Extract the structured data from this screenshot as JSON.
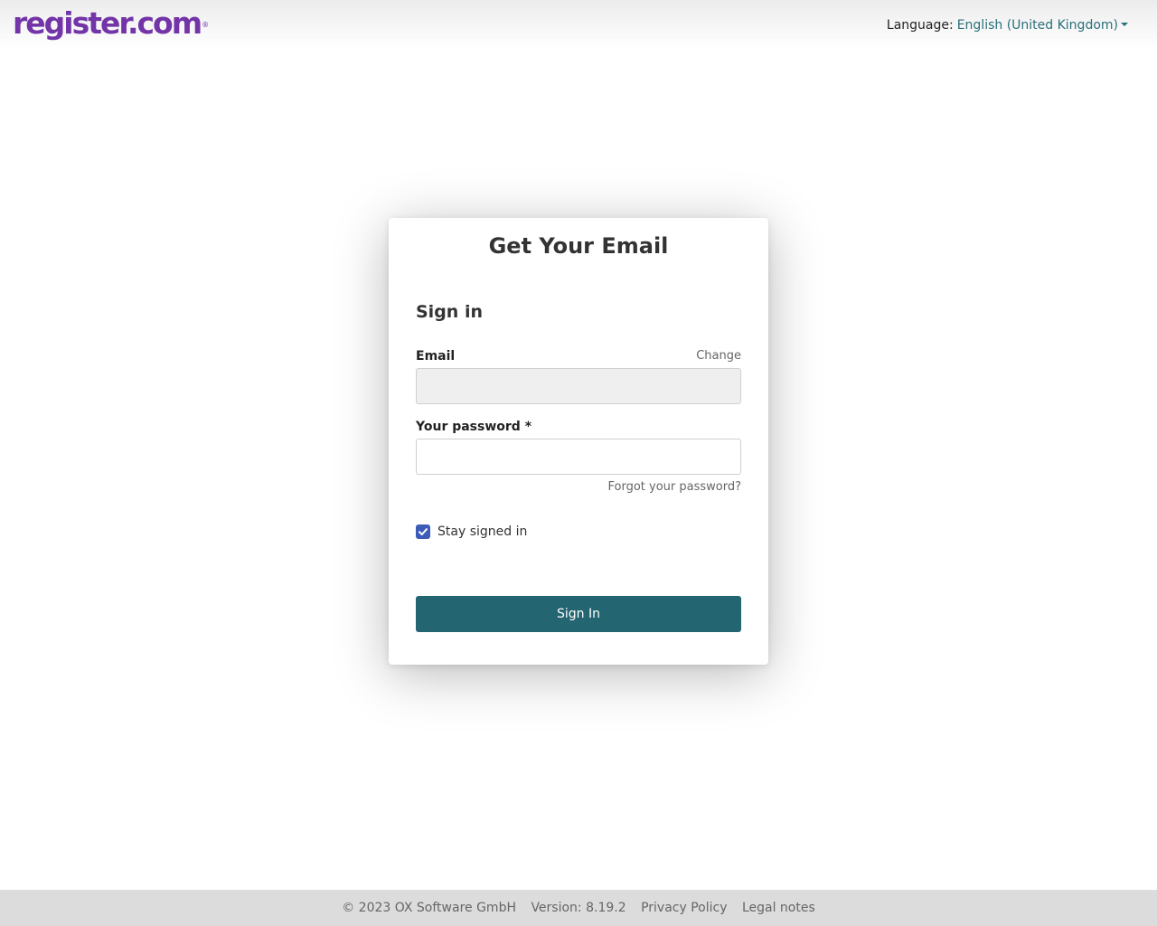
{
  "header": {
    "logo_text": "register.com",
    "logo_mark": "®",
    "language_label": "Language:",
    "language_value": "English (United Kingdom)"
  },
  "card": {
    "title": "Get Your Email",
    "heading": "Sign in",
    "email_label": "Email",
    "change_link": "Change",
    "email_value": "",
    "password_label": "Your password *",
    "password_value": "",
    "forgot_link": "Forgot your password?",
    "stay_signed_in_label": "Stay signed in",
    "stay_signed_in_checked": true,
    "signin_button": "Sign In"
  },
  "footer": {
    "copyright": "© 2023 OX Software GmbH",
    "version": "Version: 8.19.2",
    "privacy": "Privacy Policy",
    "legal": "Legal notes"
  },
  "colors": {
    "brand": "#7334a8",
    "accent": "#236570",
    "link": "#2a6f7a",
    "checkbox": "#3d5cb8"
  }
}
